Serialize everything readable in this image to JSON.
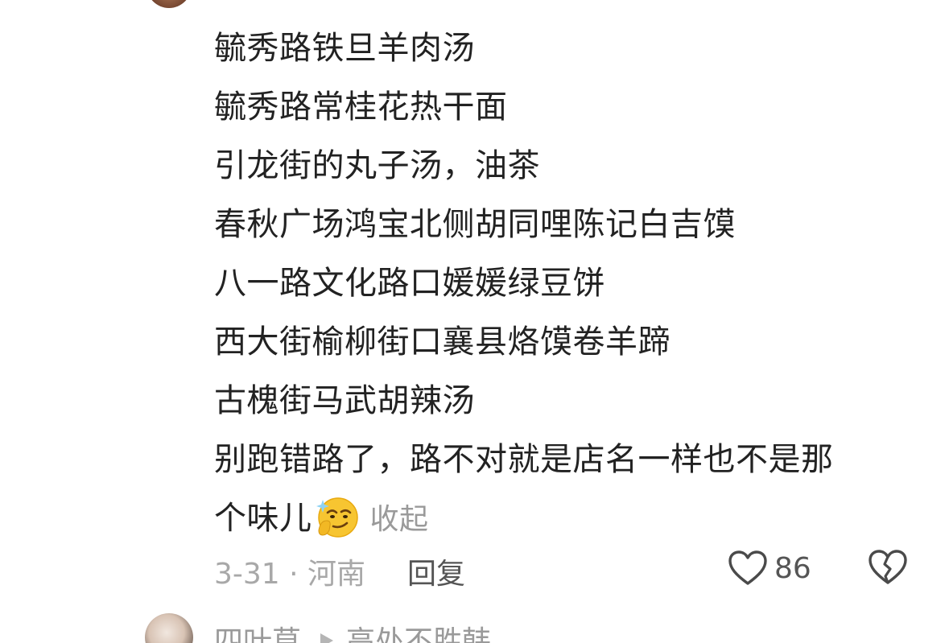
{
  "comment": {
    "lines": [
      "毓秀路铁旦羊肉汤",
      "毓秀路常桂花热干面",
      "引龙街的丸子汤，油茶",
      "春秋广场鸿宝北侧胡同哩陈记白吉馍",
      "八一路文化路口媛媛绿豆饼",
      "西大街榆柳街口襄县烙馍卷羊蹄",
      "古槐街马武胡辣汤",
      "别跑错路了，路不对就是店名一样也不是那",
      "个味儿"
    ],
    "emoji": "smirk-emoji",
    "collapse_label": "收起"
  },
  "meta": {
    "date_location": "3-31 · 河南",
    "reply_label": "回复",
    "like_count": "86",
    "like_icon": "heart-outline-icon",
    "dislike_icon": "broken-heart-icon"
  },
  "next_comment": {
    "username": "四叶草",
    "reply_to": "高处不胜韩",
    "arrow_icon": "triangle-right-icon"
  },
  "colors": {
    "text_primary": "#222222",
    "text_secondary": "#a8a8a8",
    "text_action": "#555555",
    "emoji_yellow": "#f7c531"
  }
}
